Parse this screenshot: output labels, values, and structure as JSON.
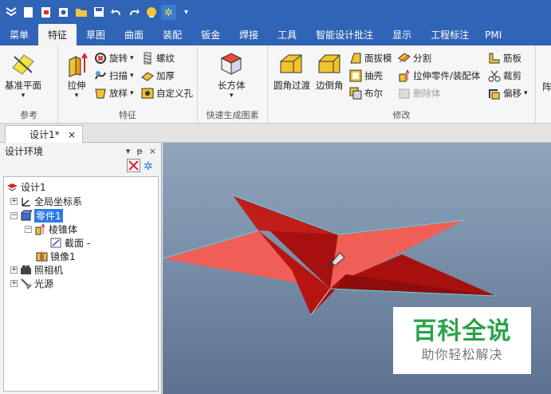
{
  "quick_access": {
    "icons": [
      "logo-icon",
      "new-icon",
      "open-icon",
      "template-icon",
      "folder-icon",
      "save-icon",
      "undo-icon",
      "redo-icon",
      "bulb-icon",
      "star-icon",
      "dropdown-icon"
    ]
  },
  "menu": {
    "tabs": [
      "菜单",
      "特征",
      "草图",
      "曲面",
      "装配",
      "钣金",
      "焊接",
      "工具",
      "智能设计批注",
      "显示",
      "工程标注",
      "PMI"
    ],
    "active": "特征"
  },
  "ribbon": {
    "reference": {
      "caption": "参考",
      "base_plane": "基准平面"
    },
    "feature": {
      "caption": "特征",
      "extrude": "拉伸",
      "revolve": "旋转",
      "sweep": "扫描",
      "loft": "放样",
      "thread": "螺纹",
      "thicken": "加厚",
      "custom_hole": "自定义孔"
    },
    "quick_gen": {
      "caption": "快速生成图素",
      "box": "长方体"
    },
    "modify": {
      "caption": "修改",
      "fillet": "圆角过渡",
      "chamfer": "边倒角",
      "draft": "面拔模",
      "shell": "抽壳",
      "boolean": "布尔",
      "split": "分割",
      "extrude_part": "拉伸零件/装配体",
      "delete_body": "删除体",
      "rib": "筋板",
      "trim": "裁剪",
      "offset": "偏移"
    },
    "cut_label": "阵"
  },
  "document": {
    "tab_label": "设计1*",
    "close": "×"
  },
  "design_panel": {
    "title": "设计环境",
    "pin": "▾",
    "dock": "ᵽ",
    "close": "×"
  },
  "tree": {
    "root": "设计1",
    "global_cs": "全局坐标系",
    "part": "零件1",
    "pyramid": "棱锥体",
    "section": "截面 -",
    "mirror": "镜像1",
    "camera": "照相机",
    "light": "光源"
  },
  "watermark": {
    "title": "百科全说",
    "subtitle": "助你轻松解决"
  },
  "colors": {
    "accent": "#2f64b6",
    "model_dark": "#a8100f",
    "model_light": "#f05e58",
    "watermark_green": "#2aa24a"
  }
}
